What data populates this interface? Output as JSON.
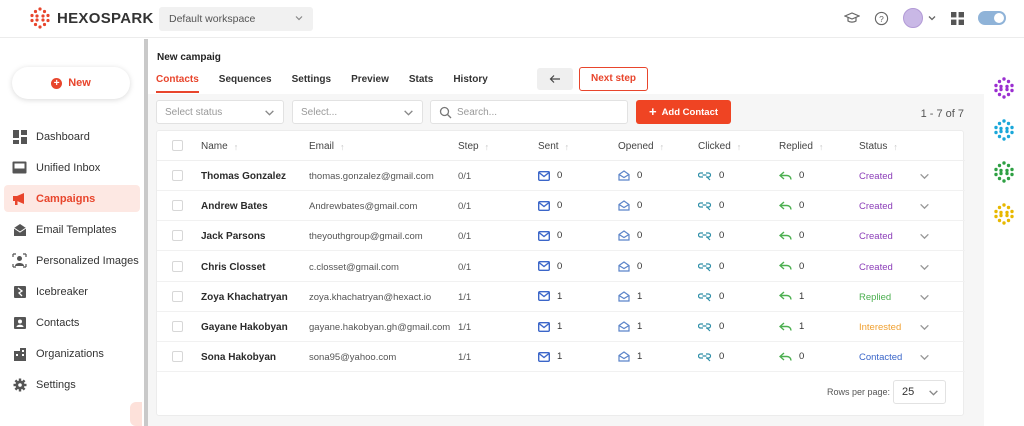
{
  "app": {
    "name": "HEXOSPARK",
    "workspace": "Default workspace"
  },
  "sidebar": {
    "new_label": "New",
    "items": [
      {
        "label": "Dashboard",
        "icon": "dashboard-icon"
      },
      {
        "label": "Unified Inbox",
        "icon": "inbox-icon"
      },
      {
        "label": "Campaigns",
        "icon": "megaphone-icon",
        "active": true
      },
      {
        "label": "Email Templates",
        "icon": "email-template-icon"
      },
      {
        "label": "Personalized Images",
        "icon": "personalized-image-icon"
      },
      {
        "label": "Icebreaker",
        "icon": "icebreaker-icon"
      },
      {
        "label": "Contacts",
        "icon": "contact-icon"
      },
      {
        "label": "Organizations",
        "icon": "organization-icon"
      },
      {
        "label": "Settings",
        "icon": "gear-icon"
      }
    ]
  },
  "campaign": {
    "title": "New campaig",
    "tabs": [
      "Contacts",
      "Sequences",
      "Settings",
      "Preview",
      "Stats",
      "History"
    ],
    "next_label": "Next step"
  },
  "filters": {
    "status_placeholder": "Select status",
    "select_placeholder": "Select...",
    "search_placeholder": "Search...",
    "add_label": "Add Contact",
    "range": "1 - 7 of 7"
  },
  "table": {
    "columns": [
      "Name",
      "Email",
      "Step",
      "Sent",
      "Opened",
      "Clicked",
      "Replied",
      "Status"
    ],
    "rows": [
      {
        "name": "Thomas Gonzalez",
        "email": "thomas.gonzalez@gmail.com",
        "step": "0/1",
        "sent": "0",
        "opened": "0",
        "clicked": "0",
        "replied": "0",
        "status": "Created"
      },
      {
        "name": "Andrew Bates",
        "email": "Andrewbates@gmail.com",
        "step": "0/1",
        "sent": "0",
        "opened": "0",
        "clicked": "0",
        "replied": "0",
        "status": "Created"
      },
      {
        "name": "Jack Parsons",
        "email": "theyouthgroup@gmail.com",
        "step": "0/1",
        "sent": "0",
        "opened": "0",
        "clicked": "0",
        "replied": "0",
        "status": "Created"
      },
      {
        "name": "Chris Closset",
        "email": "c.closset@gmail.com",
        "step": "0/1",
        "sent": "0",
        "opened": "0",
        "clicked": "0",
        "replied": "0",
        "status": "Created"
      },
      {
        "name": "Zoya Khachatryan",
        "email": "zoya.khachatryan@hexact.io",
        "step": "1/1",
        "sent": "1",
        "opened": "1",
        "clicked": "0",
        "replied": "1",
        "status": "Replied"
      },
      {
        "name": "Gayane Hakobyan",
        "email": "gayane.hakobyan.gh@gmail.com",
        "step": "1/1",
        "sent": "1",
        "opened": "1",
        "clicked": "0",
        "replied": "1",
        "status": "Interested"
      },
      {
        "name": "Sona Hakobyan",
        "email": "sona95@yahoo.com",
        "step": "1/1",
        "sent": "1",
        "opened": "1",
        "clicked": "0",
        "replied": "0",
        "status": "Contacted"
      }
    ],
    "rows_per_page_label": "Rows per page:",
    "rows_per_page": "25"
  },
  "colors": {
    "accent": "#e8452c",
    "created": "#8b3db8",
    "replied": "#4caf50",
    "interested": "#f0a030",
    "contacted": "#3b66c9",
    "rail_icons": [
      "#9b2fd1",
      "#1aa7d9",
      "#2ea043",
      "#e8b800"
    ]
  }
}
